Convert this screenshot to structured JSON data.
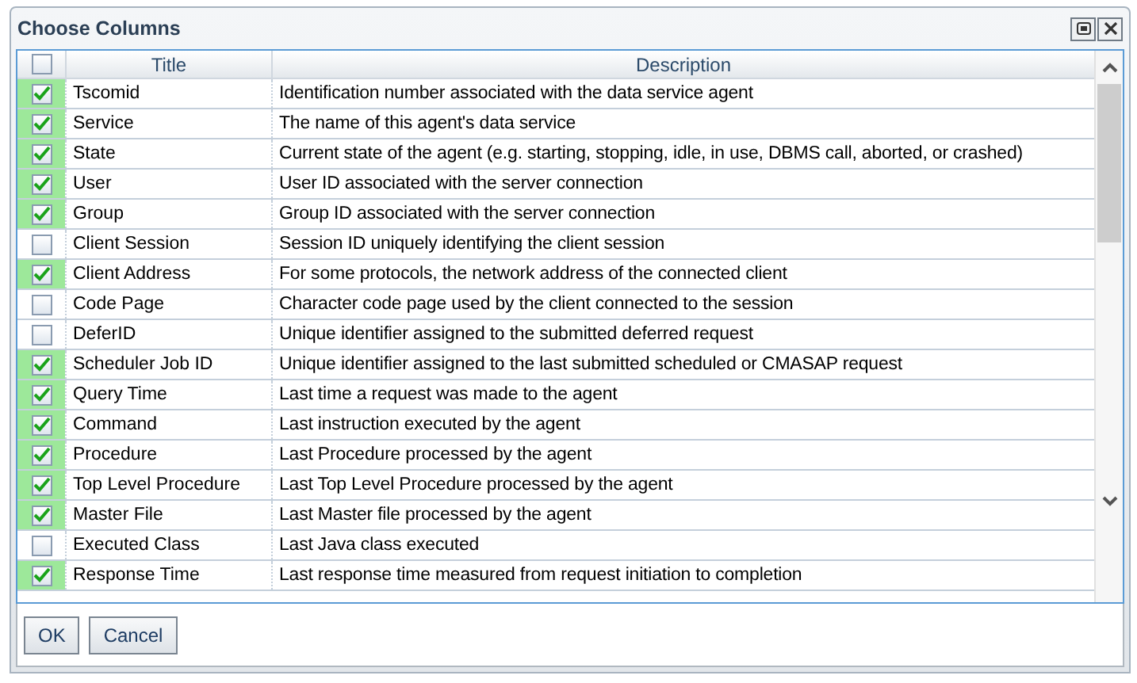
{
  "window": {
    "title": "Choose Columns"
  },
  "table": {
    "select_all": {
      "checked": false
    },
    "columns": [
      "Title",
      "Description"
    ],
    "rows": [
      {
        "checked": true,
        "title": "Tscomid",
        "description": "Identification number associated with the data service agent"
      },
      {
        "checked": true,
        "title": "Service",
        "description": "The name of this agent's data service"
      },
      {
        "checked": true,
        "title": "State",
        "description": "Current state of the agent (e.g. starting, stopping, idle, in use, DBMS call, aborted, or crashed)"
      },
      {
        "checked": true,
        "title": "User",
        "description": "User ID associated with the server connection"
      },
      {
        "checked": true,
        "title": "Group",
        "description": "Group ID associated with the server connection"
      },
      {
        "checked": false,
        "title": "Client Session",
        "description": "Session ID uniquely identifying the client session"
      },
      {
        "checked": true,
        "title": "Client Address",
        "description": "For some protocols, the network address of the connected client"
      },
      {
        "checked": false,
        "title": "Code Page",
        "description": "Character code page used by the client connected to the session"
      },
      {
        "checked": false,
        "title": "DeferID",
        "description": "Unique identifier assigned to the submitted deferred request"
      },
      {
        "checked": true,
        "title": "Scheduler Job ID",
        "description": "Unique identifier assigned to the last submitted scheduled or CMASAP request"
      },
      {
        "checked": true,
        "title": "Query Time",
        "description": "Last time a request was made to the agent"
      },
      {
        "checked": true,
        "title": "Command",
        "description": "Last instruction executed by the agent"
      },
      {
        "checked": true,
        "title": "Procedure",
        "description": "Last Procedure processed by the agent"
      },
      {
        "checked": true,
        "title": "Top Level Procedure",
        "description": "Last Top Level Procedure processed by the agent"
      },
      {
        "checked": true,
        "title": "Master File",
        "description": "Last Master file processed by the agent"
      },
      {
        "checked": false,
        "title": "Executed Class",
        "description": "Last Java class executed"
      },
      {
        "checked": true,
        "title": "Response Time",
        "description": "Last response time measured from request initiation to completion"
      }
    ]
  },
  "buttons": [
    "OK",
    "Cancel"
  ]
}
